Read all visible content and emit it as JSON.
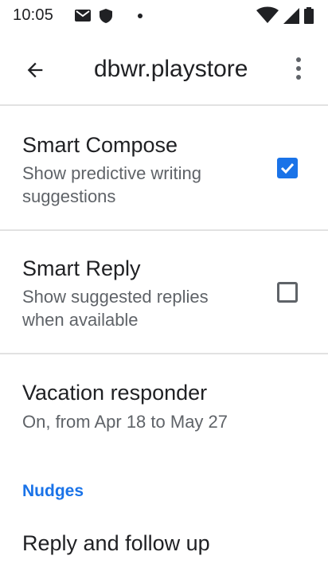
{
  "status_bar": {
    "time": "10:05",
    "left_icons": [
      "gmail-icon",
      "shield-icon",
      "dot-icon"
    ],
    "right_icons": [
      "wifi-icon",
      "signal-icon",
      "battery-icon"
    ]
  },
  "app_bar": {
    "back_icon": "back-arrow-icon",
    "title": "dbwr.playstore",
    "overflow_icon": "more-vert-icon"
  },
  "settings": {
    "smart_compose": {
      "title": "Smart Compose",
      "summary": "Show predictive writing suggestions",
      "checked": true
    },
    "smart_reply": {
      "title": "Smart Reply",
      "summary": "Show suggested replies when available",
      "checked": false
    },
    "vacation_responder": {
      "title": "Vacation responder",
      "summary": "On, from Apr 18 to May 27"
    },
    "nudges_header": "Nudges",
    "reply_follow_up": {
      "title": "Reply and follow up"
    }
  },
  "colors": {
    "accent": "#1a73e8",
    "text_primary": "#202124",
    "text_secondary": "#5f6368",
    "divider": "#e2e2e2"
  }
}
